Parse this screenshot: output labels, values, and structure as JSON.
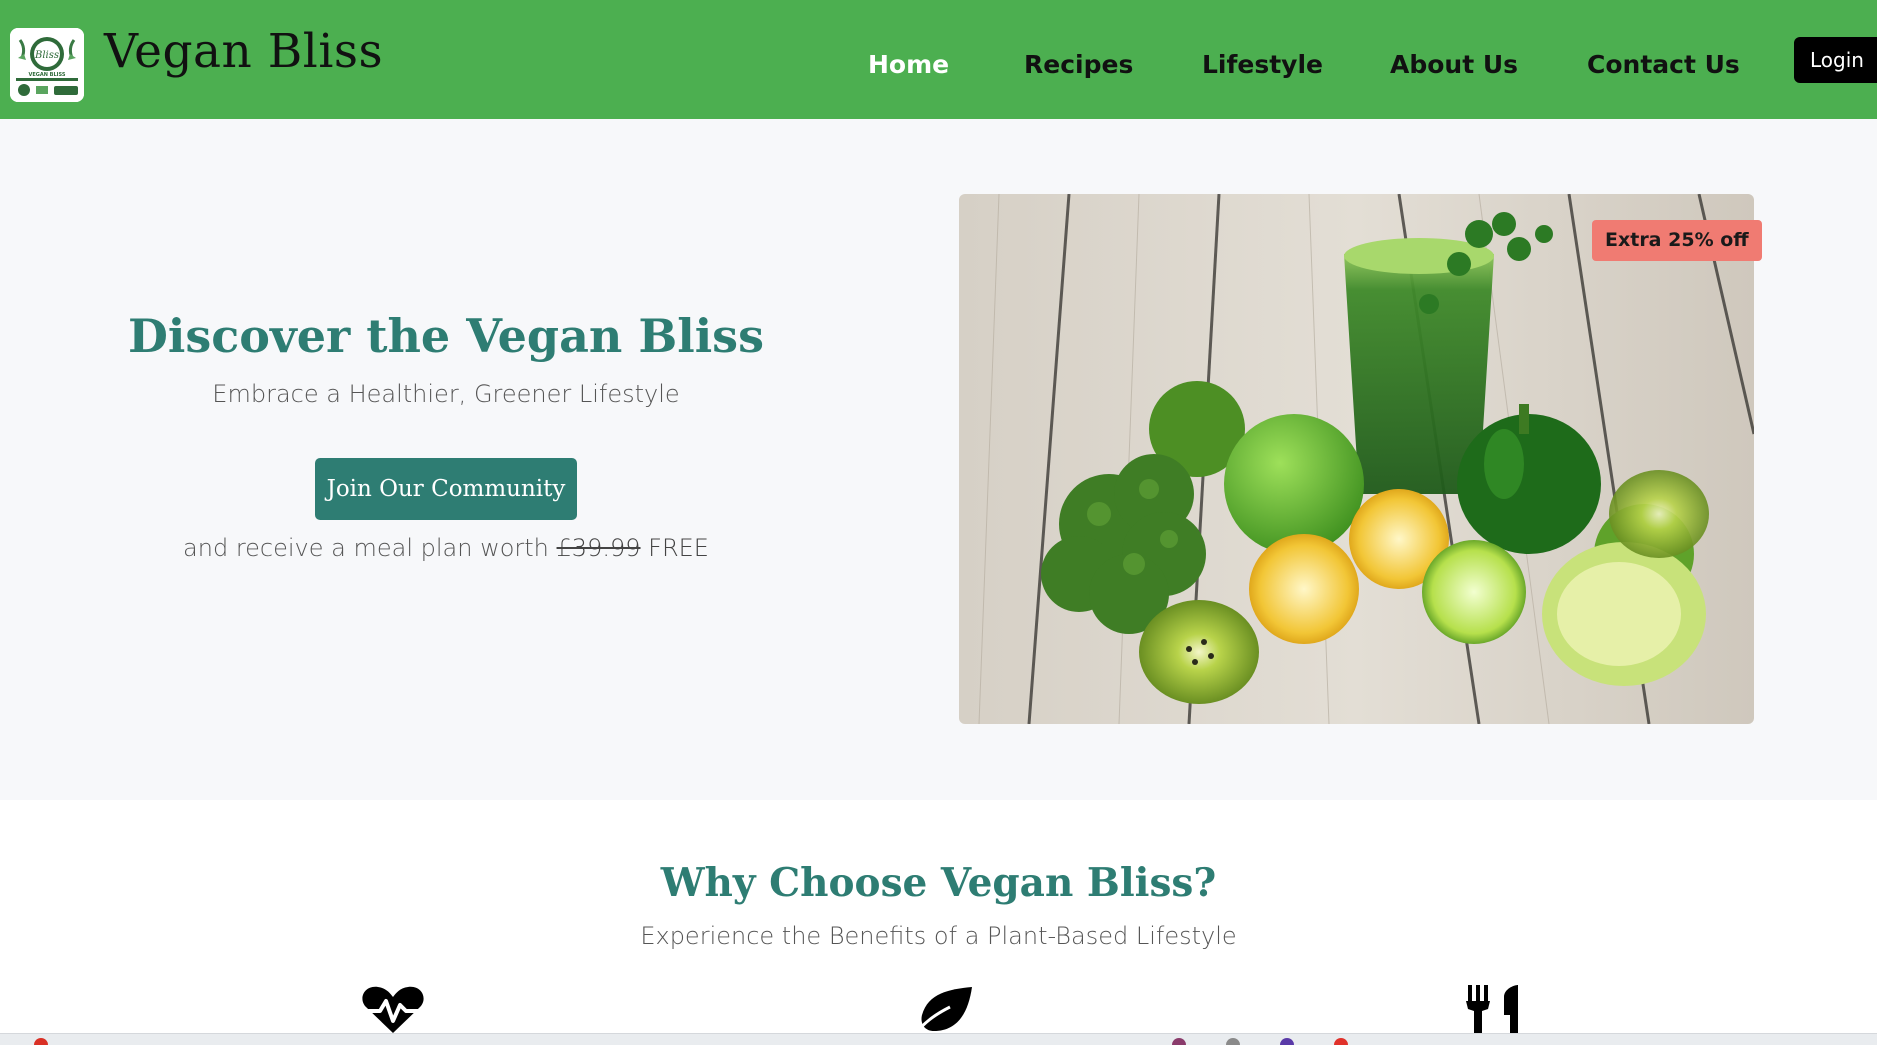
{
  "header": {
    "brand": "Vegan Bliss",
    "logo_text": "Bliss",
    "logo_subtext": "VEGAN BLISS",
    "nav": [
      {
        "label": "Home",
        "active": true
      },
      {
        "label": "Recipes",
        "active": false
      },
      {
        "label": "Lifestyle",
        "active": false
      },
      {
        "label": "About Us",
        "active": false
      },
      {
        "label": "Contact Us",
        "active": false
      }
    ],
    "login_label": "Login"
  },
  "hero": {
    "title": "Discover the Vegan Bliss",
    "subtitle": "Embrace a Healthier, Greener Lifestyle",
    "cta_label": "Join Our Community",
    "offer_prefix": "and receive a meal plan worth",
    "offer_old_price": "£39.99",
    "offer_suffix": "FREE",
    "badge": "Extra 25% off"
  },
  "why": {
    "title": "Why Choose Vegan Bliss?",
    "subtitle": "Experience the Benefits of a Plant-Based Lifestyle",
    "features": [
      {
        "icon": "heartbeat-icon"
      },
      {
        "icon": "leaf-icon"
      },
      {
        "icon": "utensils-icon"
      }
    ]
  },
  "colors": {
    "header_bg": "#4caf50",
    "accent": "#2e7d73",
    "badge_bg": "#f07b72"
  }
}
